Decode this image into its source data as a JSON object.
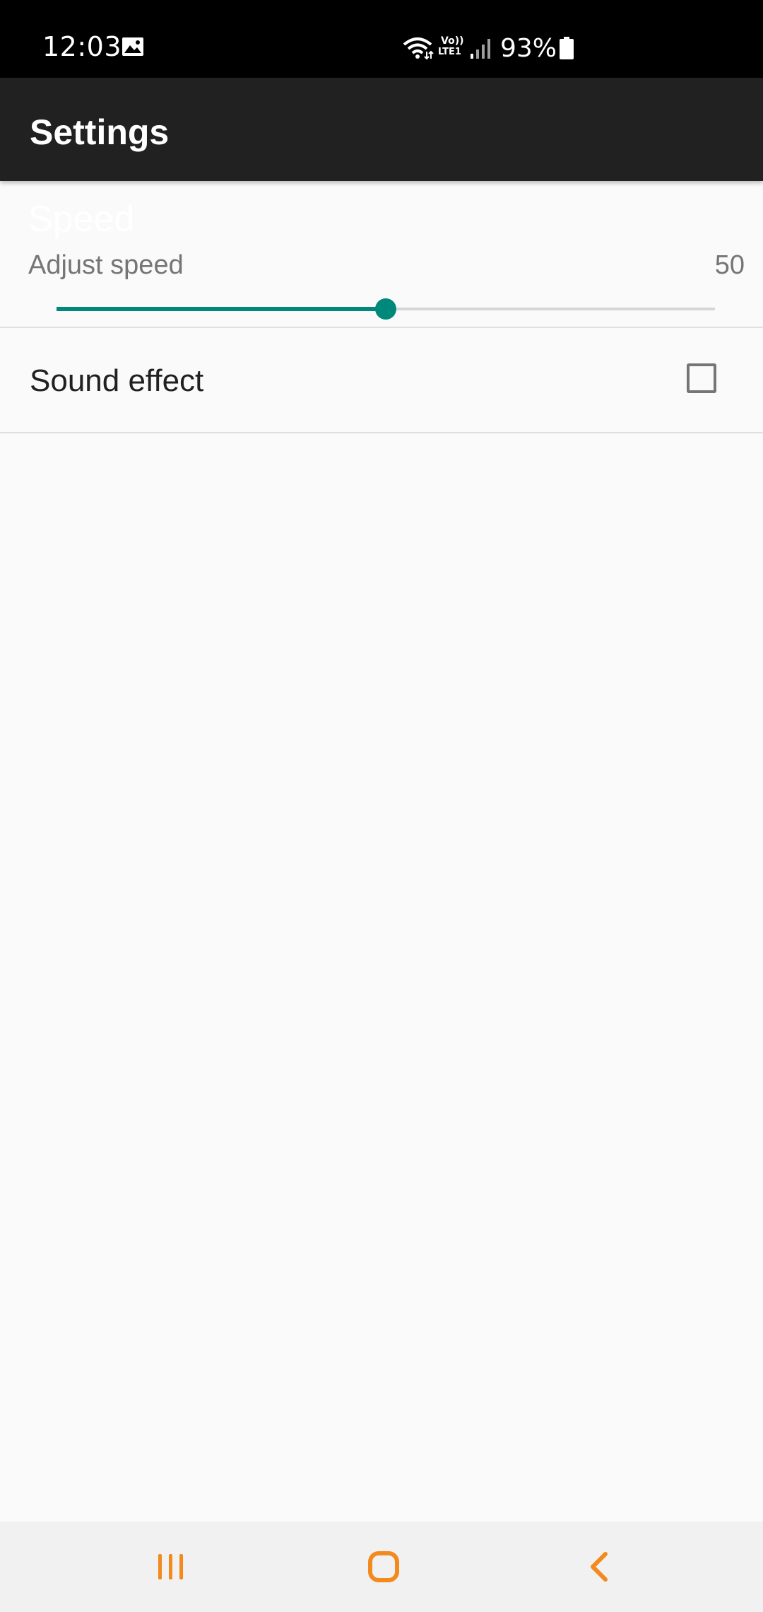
{
  "status_bar": {
    "time": "12:03",
    "battery_percent": "93%",
    "lte_top": "Vo))",
    "lte_bottom": "LTE1",
    "icons": [
      "image-icon",
      "wifi-icon",
      "volte-icon",
      "signal-icon",
      "battery-icon"
    ]
  },
  "app_bar": {
    "title": "Settings"
  },
  "settings": {
    "speed": {
      "title": "Speed",
      "summary": "Adjust speed",
      "value": "50",
      "slider_fraction": 0.5
    },
    "sound_effect": {
      "label": "Sound effect",
      "checked": false
    }
  },
  "nav_bar": {
    "buttons": [
      "recent-apps-icon",
      "home-icon",
      "back-icon"
    ]
  },
  "colors": {
    "accent": "#00897b",
    "app_bar": "#212121",
    "status_bar": "#000000",
    "nav_icons": "#f28a1e",
    "background": "#fafafa"
  }
}
